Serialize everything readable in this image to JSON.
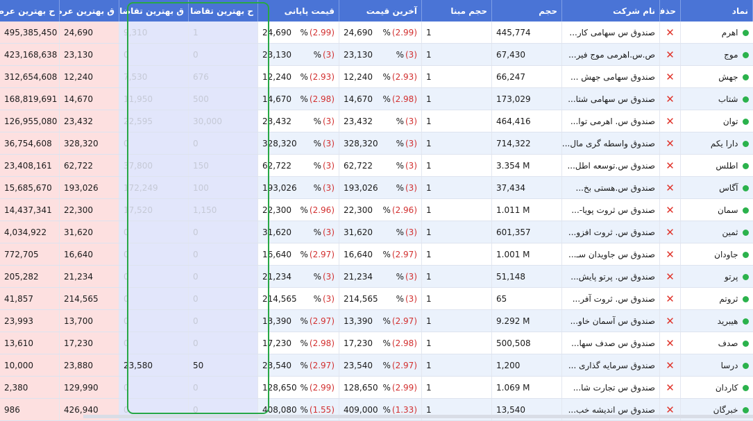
{
  "headers": {
    "symbol": "نماد",
    "delete": "حذف",
    "company": "نام شرکت",
    "volume": "حجم",
    "base_volume": "حجم مبنا",
    "last_price": "آخرین قیمت",
    "close_price": "قیمت پایانی",
    "best_bid_vol": "ح بهترین تقاضا",
    "best_bid_price": "ق بهترین تقاضا",
    "best_ask_price": "ق بهترین عرضه",
    "best_ask_vol": "ح بهترین عرضه"
  },
  "colors": {
    "header": "#4a74d6",
    "negative": "#d23030",
    "ask_bg": "#fde0e0",
    "bid_bg": "#e2e6fb",
    "highlight": "#27a745",
    "status_dot": "#2bb24c"
  },
  "icons": {
    "status": "green-dot-icon",
    "delete": "red-x-icon"
  },
  "rows": [
    {
      "symbol": "اهرم",
      "delete": "✕",
      "company": "صندوق س سهامی کار...",
      "volume": "445,774",
      "base_volume": "1",
      "last_price": "24,690",
      "last_pct": "(2.99)",
      "close_price": "24,690",
      "close_pct": "(2.99)",
      "pct_sign": "%",
      "bid_vol": "1",
      "bid_price": "9,310",
      "ask_price": "24,690",
      "ask_vol": "495,385,450"
    },
    {
      "symbol": "موج",
      "delete": "✕",
      "company": "ص.س.اهرمی موج فیر...",
      "volume": "67,430",
      "base_volume": "1",
      "last_price": "23,130",
      "last_pct": "(3)",
      "close_price": "23,130",
      "close_pct": "(3)",
      "pct_sign": "%",
      "bid_vol": "0",
      "bid_price": "0",
      "ask_price": "23,130",
      "ask_vol": "423,168,638"
    },
    {
      "symbol": "جهش",
      "delete": "✕",
      "company": "صندوق سهامی جهش ...",
      "volume": "66,247",
      "base_volume": "1",
      "last_price": "12,240",
      "last_pct": "(2.93)",
      "close_price": "12,240",
      "close_pct": "(2.93)",
      "pct_sign": "%",
      "bid_vol": "676",
      "bid_price": "7,530",
      "ask_price": "12,240",
      "ask_vol": "312,654,608"
    },
    {
      "symbol": "شتاب",
      "delete": "✕",
      "company": "صندوق س سهامی شتا...",
      "volume": "173,029",
      "base_volume": "1",
      "last_price": "14,670",
      "last_pct": "(2.98)",
      "close_price": "14,670",
      "close_pct": "(2.98)",
      "pct_sign": "%",
      "bid_vol": "500",
      "bid_price": "11,950",
      "ask_price": "14,670",
      "ask_vol": "168,819,691"
    },
    {
      "symbol": "توان",
      "delete": "✕",
      "company": "صندوق س. اهرمی توا...",
      "volume": "464,416",
      "base_volume": "1",
      "last_price": "23,432",
      "last_pct": "(3)",
      "close_price": "23,432",
      "close_pct": "(3)",
      "pct_sign": "%",
      "bid_vol": "30,000",
      "bid_price": "22,595",
      "ask_price": "23,432",
      "ask_vol": "126,955,080"
    },
    {
      "symbol": "دارا یکم",
      "delete": "✕",
      "company": "صندوق واسطه گری مال...",
      "volume": "714,322",
      "base_volume": "1",
      "last_price": "328,320",
      "last_pct": "(3)",
      "close_price": "328,320",
      "close_pct": "(3)",
      "pct_sign": "%",
      "bid_vol": "0",
      "bid_price": "0",
      "ask_price": "328,320",
      "ask_vol": "36,754,608"
    },
    {
      "symbol": "اطلس",
      "delete": "✕",
      "company": "صندوق س.توسعه اطل...",
      "volume": "3.354 M",
      "base_volume": "1",
      "last_price": "62,722",
      "last_pct": "(3)",
      "close_price": "62,722",
      "close_pct": "(3)",
      "pct_sign": "%",
      "bid_vol": "150",
      "bid_price": "37,800",
      "ask_price": "62,722",
      "ask_vol": "23,408,161"
    },
    {
      "symbol": "آگاس",
      "delete": "✕",
      "company": "صندوق س.هستی بخ...",
      "volume": "37,434",
      "base_volume": "1",
      "last_price": "193,026",
      "last_pct": "(3)",
      "close_price": "193,026",
      "close_pct": "(3)",
      "pct_sign": "%",
      "bid_vol": "100",
      "bid_price": "172,249",
      "ask_price": "193,026",
      "ask_vol": "15,685,670"
    },
    {
      "symbol": "سمان",
      "delete": "✕",
      "company": "صندوق س ثروت پویا-...",
      "volume": "1.011 M",
      "base_volume": "1",
      "last_price": "22,300",
      "last_pct": "(2.96)",
      "close_price": "22,300",
      "close_pct": "(2.96)",
      "pct_sign": "%",
      "bid_vol": "1,150",
      "bid_price": "17,520",
      "ask_price": "22,300",
      "ask_vol": "14,437,341"
    },
    {
      "symbol": "ثمین",
      "delete": "✕",
      "company": "صندوق س. ثروت افزو...",
      "volume": "601,357",
      "base_volume": "1",
      "last_price": "31,620",
      "last_pct": "(3)",
      "close_price": "31,620",
      "close_pct": "(3)",
      "pct_sign": "%",
      "bid_vol": "0",
      "bid_price": "0",
      "ask_price": "31,620",
      "ask_vol": "4,034,922"
    },
    {
      "symbol": "جاودان",
      "delete": "✕",
      "company": "صندوق س جاویدان سـ...",
      "volume": "1.001 M",
      "base_volume": "1",
      "last_price": "16,640",
      "last_pct": "(2.97)",
      "close_price": "16,640",
      "close_pct": "(2.97)",
      "pct_sign": "%",
      "bid_vol": "0",
      "bid_price": "0",
      "ask_price": "16,640",
      "ask_vol": "772,705"
    },
    {
      "symbol": "پرتو",
      "delete": "✕",
      "company": "صندوق س. پرتو پایش...",
      "volume": "51,148",
      "base_volume": "1",
      "last_price": "21,234",
      "last_pct": "(3)",
      "close_price": "21,234",
      "close_pct": "(3)",
      "pct_sign": "%",
      "bid_vol": "0",
      "bid_price": "0",
      "ask_price": "21,234",
      "ask_vol": "205,282"
    },
    {
      "symbol": "ثروتم",
      "delete": "✕",
      "company": "صندوق س. ثروت آفر...",
      "volume": "65",
      "base_volume": "1",
      "last_price": "214,565",
      "last_pct": "(3)",
      "close_price": "214,565",
      "close_pct": "(3)",
      "pct_sign": "%",
      "bid_vol": "0",
      "bid_price": "0",
      "ask_price": "214,565",
      "ask_vol": "41,857"
    },
    {
      "symbol": "هیبرید",
      "delete": "✕",
      "company": "صندوق س آسمان خاو...",
      "volume": "9.292 M",
      "base_volume": "1",
      "last_price": "13,390",
      "last_pct": "(2.97)",
      "close_price": "13,390",
      "close_pct": "(2.97)",
      "pct_sign": "%",
      "bid_vol": "0",
      "bid_price": "0",
      "ask_price": "13,700",
      "ask_vol": "23,993"
    },
    {
      "symbol": "صدف",
      "delete": "✕",
      "company": "صندوق س صدف سها...",
      "volume": "500,508",
      "base_volume": "1",
      "last_price": "17,230",
      "last_pct": "(2.98)",
      "close_price": "17,230",
      "close_pct": "(2.98)",
      "pct_sign": "%",
      "bid_vol": "0",
      "bid_price": "0",
      "ask_price": "17,230",
      "ask_vol": "13,610"
    },
    {
      "symbol": "درسا",
      "delete": "✕",
      "company": "صندوق سرمایه گذاری ...",
      "volume": "1,200",
      "base_volume": "1",
      "last_price": "23,540",
      "last_pct": "(2.97)",
      "close_price": "23,540",
      "close_pct": "(2.97)",
      "pct_sign": "%",
      "bid_vol": "50",
      "bid_price": "23,580",
      "ask_price": "23,880",
      "ask_vol": "10,000"
    },
    {
      "symbol": "کاردان",
      "delete": "✕",
      "company": "صندوق س تجارت شا...",
      "volume": "1.069 M",
      "base_volume": "1",
      "last_price": "128,650",
      "last_pct": "(2.99)",
      "close_price": "128,650",
      "close_pct": "(2.99)",
      "pct_sign": "%",
      "bid_vol": "0",
      "bid_price": "0",
      "ask_price": "129,990",
      "ask_vol": "2,380"
    },
    {
      "symbol": "خبرگان",
      "delete": "✕",
      "company": "صندوق س اندیشه خب...",
      "volume": "13,540",
      "base_volume": "1",
      "last_price": "409,000",
      "last_pct": "(1.33)",
      "close_price": "408,080",
      "close_pct": "(1.55)",
      "pct_sign": "%",
      "bid_vol": "0",
      "bid_price": "0",
      "ask_price": "426,940",
      "ask_vol": "986"
    }
  ]
}
